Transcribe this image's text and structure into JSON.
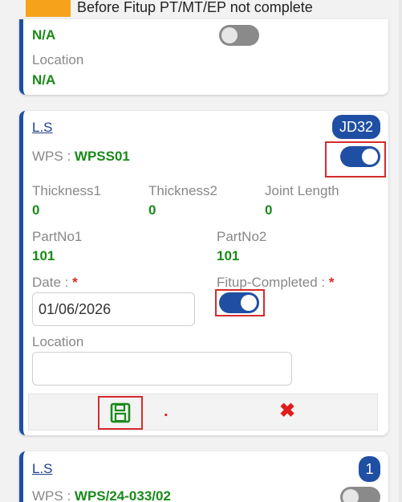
{
  "legend": {
    "text": "Before Fitup PT/MT/EP not complete",
    "color": "#f7a21b"
  },
  "top_card": {
    "value": "N/A",
    "location_label": "Location",
    "location_value": "N/A",
    "toggle_state": "off"
  },
  "main_card": {
    "title": "L.S",
    "badge": "JD32",
    "wps_label": "WPS :",
    "wps_value": "WPSS01",
    "wps_toggle": "on",
    "thickness1_label": "Thickness1",
    "thickness1_value": "0",
    "thickness2_label": "Thickness2",
    "thickness2_value": "0",
    "joint_length_label": "Joint Length",
    "joint_length_value": "0",
    "partno1_label": "PartNo1",
    "partno1_value": "101",
    "partno2_label": "PartNo2",
    "partno2_value": "101",
    "date_label": "Date :",
    "date_required": "*",
    "date_value": "01/06/2026",
    "fitup_label": "Fitup-Completed :",
    "fitup_required": "*",
    "fitup_toggle": "on",
    "location_label": "Location",
    "location_value": "",
    "dot": ".",
    "cancel_icon": "✖"
  },
  "bottom_card": {
    "title": "L.S",
    "badge": "1",
    "wps_label": "WPS :",
    "wps_value": "WPS/24-033/02",
    "toggle_state": "off"
  },
  "colors": {
    "accent": "#1f4fa3",
    "value_green": "#1a8a1a",
    "required_red": "#d62b2b",
    "card_border": "#1f4fa3"
  }
}
